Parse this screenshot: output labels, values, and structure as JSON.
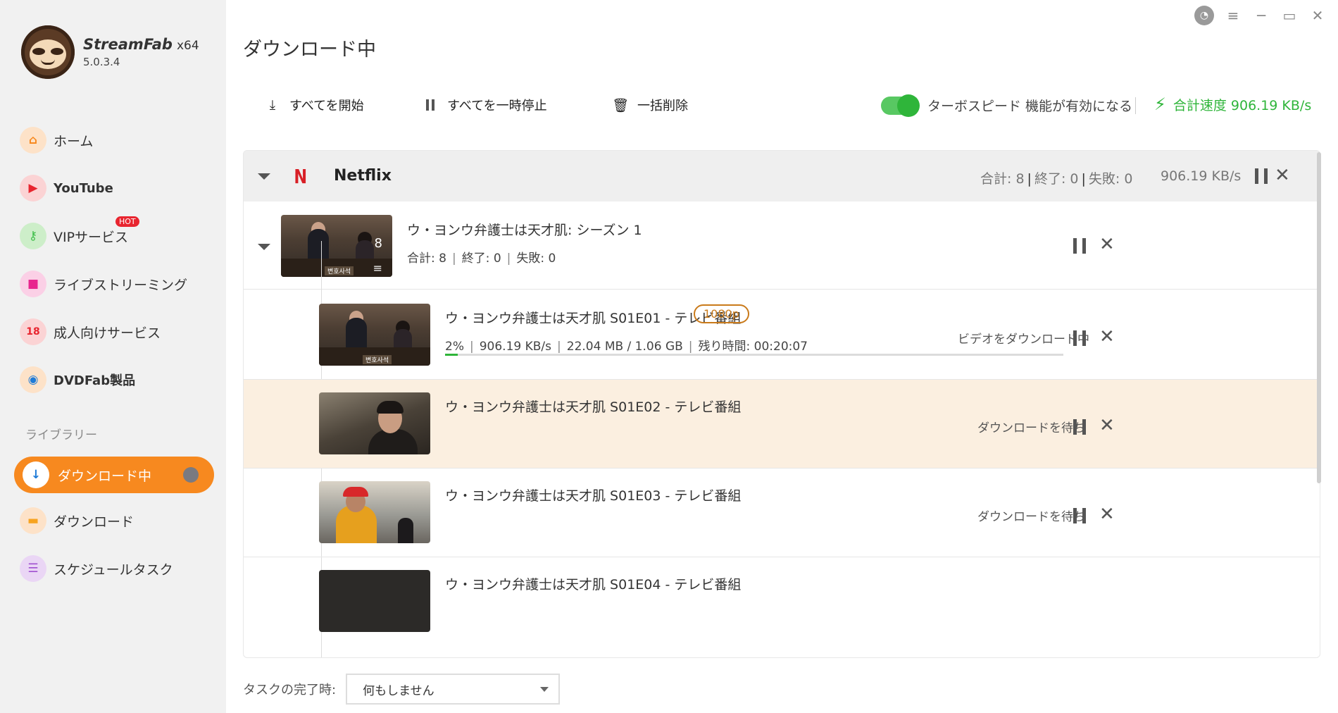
{
  "app": {
    "name": "StreamFab",
    "arch": "x64",
    "version": "5.0.3.4"
  },
  "sidebar": {
    "items": [
      {
        "label": "ホーム",
        "icon": "home-icon",
        "color": "#f7891f"
      },
      {
        "label": "YouTube",
        "icon": "youtube-icon",
        "color": "#e8252f"
      },
      {
        "label": "VIPサービス",
        "icon": "key-icon",
        "color": "#3fbf4a",
        "badge": "HOT"
      },
      {
        "label": "ライブストリーミング",
        "icon": "camera-icon",
        "color": "#e8258e"
      },
      {
        "label": "成人向けサービス",
        "icon": "adult-icon",
        "color": "#e8252f"
      },
      {
        "label": "DVDFab製品",
        "icon": "dvdfab-icon",
        "color": "#f7891f"
      }
    ],
    "library_label": "ライブラリー",
    "library": [
      {
        "label": "ダウンロード中",
        "icon": "download-icon",
        "active": true
      },
      {
        "label": "ダウンロード",
        "icon": "folder-icon",
        "color": "#f7a31f"
      },
      {
        "label": "スケジュールタスク",
        "icon": "schedule-icon",
        "color": "#a050d0"
      }
    ]
  },
  "main": {
    "title": "ダウンロード中",
    "toolbar": {
      "start_all": "すべてを開始",
      "pause_all": "すべてを一時停止",
      "delete_all": "一括削除",
      "turbo_label": "ターボスピード 機能が有効になる",
      "turbo_on": true,
      "total_speed": "合計速度 906.19 KB/s"
    },
    "group": {
      "name": "Netflix",
      "stats_total": "合計: 8",
      "stats_done": "終了: 0",
      "stats_fail": "失敗: 0",
      "speed": "906.19 KB/s"
    },
    "season": {
      "title": "ウ・ヨンウ弁護士は天才肌: シーズン 1",
      "count": "8",
      "thumb_caption": "변호사석",
      "total": "合計: 8",
      "done": "終了: 0",
      "fail": "失敗: 0"
    },
    "episodes": [
      {
        "title": "ウ・ヨンウ弁護士は天才肌 S01E01 - テレビ番組",
        "resolution": "1080p",
        "percent": "2%",
        "speed": "906.19 KB/s",
        "size": "22.04 MB / 1.06 GB",
        "remaining": "残り時間: 00:20:07",
        "status": "ビデオをダウンロード中",
        "progress": 0.02,
        "thumb_caption": "변호사석"
      },
      {
        "title": "ウ・ヨンウ弁護士は天才肌 S01E02 - テレビ番組",
        "status": "ダウンロードを待ち"
      },
      {
        "title": "ウ・ヨンウ弁護士は天才肌 S01E03 - テレビ番組",
        "status": "ダウンロードを待ち"
      },
      {
        "title": "ウ・ヨンウ弁護士は天才肌 S01E04 - テレビ番組"
      }
    ],
    "completion_label": "タスクの完了時:",
    "completion_value": "何もしません"
  },
  "colors": {
    "accent": "#f7891f",
    "turbo_green": "#2fb53a",
    "netflix_red": "#d81f26",
    "row_highlight": "#fbefe0"
  }
}
